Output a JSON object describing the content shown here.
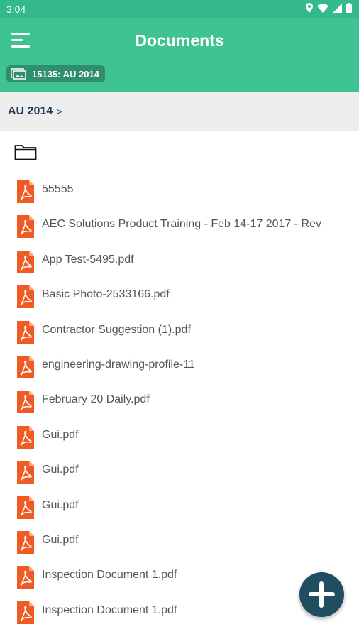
{
  "status_bar": {
    "time": "3:04",
    "icons": [
      "location-icon",
      "wifi-icon",
      "signal-icon",
      "battery-icon"
    ]
  },
  "header": {
    "title": "Documents",
    "project_chip": "15135: AU 2014"
  },
  "breadcrumb": {
    "label": "AU 2014",
    "separator": ">"
  },
  "files": [
    {
      "name": "55555"
    },
    {
      "name": "AEC Solutions Product Training - Feb 14-17 2017 - Rev"
    },
    {
      "name": "App Test-5495.pdf"
    },
    {
      "name": "Basic Photo-2533166.pdf"
    },
    {
      "name": "Contractor Suggestion (1).pdf"
    },
    {
      "name": "engineering-drawing-profile-11"
    },
    {
      "name": "February 20 Daily.pdf"
    },
    {
      "name": "Gui.pdf"
    },
    {
      "name": "Gui.pdf"
    },
    {
      "name": "Gui.pdf"
    },
    {
      "name": "Gui.pdf"
    },
    {
      "name": "Inspection Document 1.pdf"
    },
    {
      "name": "Inspection Document 1.pdf"
    }
  ],
  "colors": {
    "status_bar": "#33b98a",
    "app_bar": "#40c393",
    "chip": "#2f8f6c",
    "breadcrumb_bg": "#ededed",
    "breadcrumb_text": "#1e3a5a",
    "pdf_icon": "#f05a23",
    "fab": "#214d60"
  }
}
